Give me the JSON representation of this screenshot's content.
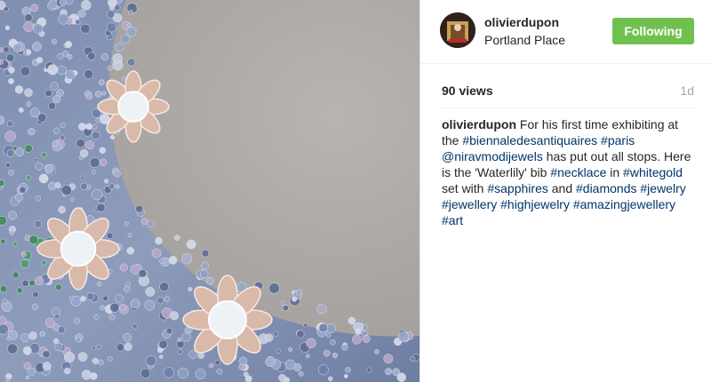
{
  "post": {
    "media_alt": "Waterlily bib necklace photo"
  },
  "header": {
    "username": "olivierdupon",
    "location": "Portland Place",
    "follow_label": "Following",
    "follow_color": "#70c050"
  },
  "stats": {
    "views": "90 views",
    "age": "1d"
  },
  "caption": {
    "username": "olivierdupon",
    "segments": [
      {
        "type": "text",
        "text": " For his first time exhibiting at the "
      },
      {
        "type": "tag",
        "text": "#biennaledesantiquaires"
      },
      {
        "type": "text",
        "text": " "
      },
      {
        "type": "tag",
        "text": "#paris"
      },
      {
        "type": "text",
        "text": " "
      },
      {
        "type": "tag",
        "text": "@niravmodijewels"
      },
      {
        "type": "text",
        "text": " has put out all stops. Here is the 'Waterlily' bib "
      },
      {
        "type": "tag",
        "text": "#necklace"
      },
      {
        "type": "text",
        "text": " in "
      },
      {
        "type": "tag",
        "text": "#whitegold"
      },
      {
        "type": "text",
        "text": " set with "
      },
      {
        "type": "tag",
        "text": "#sapphires"
      },
      {
        "type": "text",
        "text": " and "
      },
      {
        "type": "tag",
        "text": "#diamonds"
      },
      {
        "type": "text",
        "text": " "
      },
      {
        "type": "tag",
        "text": "#jewelry"
      },
      {
        "type": "text",
        "text": " "
      },
      {
        "type": "tag",
        "text": "#jewellery"
      },
      {
        "type": "text",
        "text": " "
      },
      {
        "type": "tag",
        "text": "#highjewelry"
      },
      {
        "type": "text",
        "text": " "
      },
      {
        "type": "tag",
        "text": "#amazingjewellery"
      },
      {
        "type": "text",
        "text": " "
      },
      {
        "type": "tag",
        "text": "#art"
      }
    ]
  },
  "colors": {
    "text": "#262626",
    "hashtag": "#003569",
    "muted": "#a5a7aa"
  }
}
